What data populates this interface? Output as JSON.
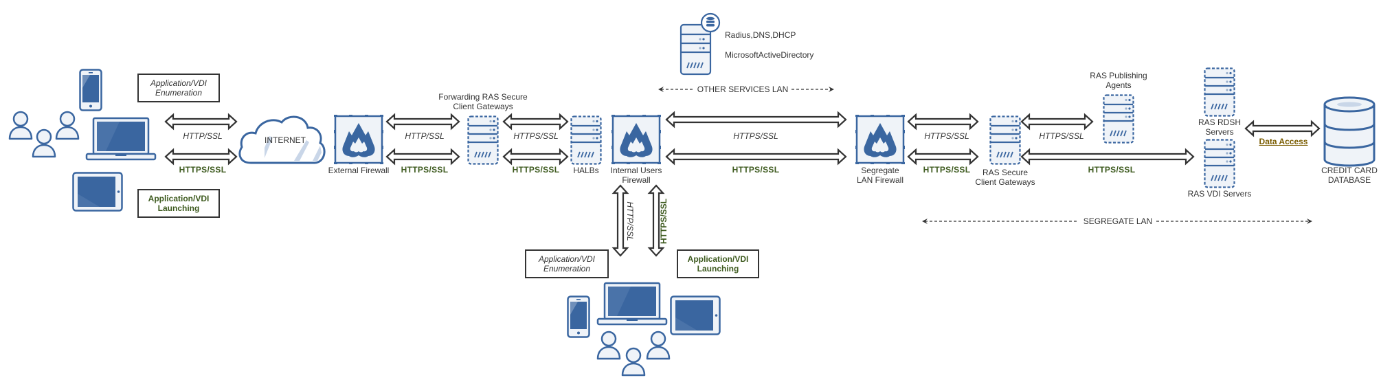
{
  "colors": {
    "icon_blue": "#3a66a0",
    "icon_fill": "#eff3f8",
    "arrow_stroke": "#333333",
    "bold_green": "#3d5a1e",
    "link_gold": "#7a5c00"
  },
  "external_users": {
    "devices": [
      "users-icon",
      "phone-icon",
      "laptop-icon",
      "tablet-icon"
    ],
    "enumeration_box": {
      "line1": "Application/VDI",
      "line2": "Enumeration"
    },
    "launching_box": {
      "line1": "Application/VDI",
      "line2": "Launching"
    }
  },
  "links": {
    "ext_http": "HTTP/SSL",
    "ext_https": "HTTPS/SSL",
    "fw_http": "HTTP/SSL",
    "fw_https": "HTTPS/SSL",
    "gw_https_top": "HTTPS/SSL",
    "gw_https_bottom": "HTTPS/SSL",
    "core_https_top": "HTTPS/SSL",
    "core_https_bottom": "HTTPS/SSL",
    "seg_https_top": "HTTPS/SSL",
    "seg_https_bottom": "HTTPS/SSL",
    "pub_https": "HTTPS/SSL",
    "vdi_https": "HTTPS/SSL",
    "internal_http": "HTTP/SSL",
    "internal_https": "HTTPS/SSL",
    "data_access": "Data Access"
  },
  "nodes": {
    "internet": "INTERNET",
    "external_firewall": "External Firewall",
    "forwarding_gateways": {
      "line1": "Forwarding RAS Secure",
      "line2": "Client Gateways"
    },
    "halbs": "HALBs",
    "internal_firewall": {
      "line1": "Internal Users",
      "line2": "Firewall"
    },
    "other_services": {
      "line1": "Radius,DNS,DHCP",
      "line2": "MicrosoftActiveDirectory"
    },
    "segregate_firewall": {
      "line1": "Segregate",
      "line2": "LAN Firewall"
    },
    "ras_gateways": {
      "line1": "RAS Secure",
      "line2": "Client Gateways"
    },
    "publishing_agents": {
      "line1": "RAS Publishing",
      "line2": "Agents"
    },
    "rdsh_servers": {
      "line1": "RAS RDSH",
      "line2": "Servers"
    },
    "vdi_servers": "RAS VDI Servers",
    "database": {
      "line1": "CREDIT CARD",
      "line2": "DATABASE"
    }
  },
  "lans": {
    "other_services": "OTHER SERVICES LAN",
    "segregate": "SEGREGATE LAN"
  },
  "internal_users": {
    "devices": [
      "phone-icon",
      "laptop-icon",
      "tablet-icon",
      "users-icon"
    ],
    "enumeration_box": {
      "line1": "Application/VDI",
      "line2": "Enumeration"
    },
    "launching_box": {
      "line1": "Application/VDI",
      "line2": "Launching"
    }
  }
}
